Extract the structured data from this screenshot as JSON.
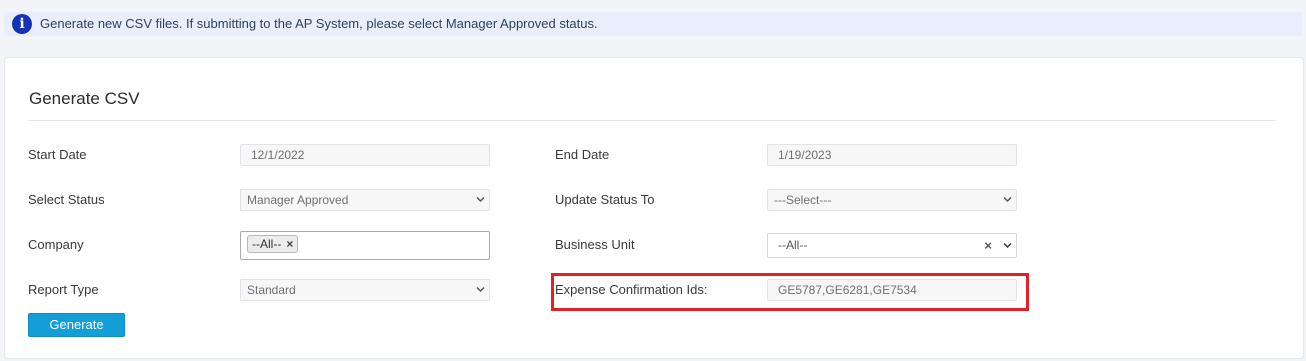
{
  "info": {
    "text": "Generate new CSV files. If submitting to the AP System, please select Manager Approved status."
  },
  "form": {
    "title": "Generate CSV",
    "start_date_label": "Start Date",
    "start_date_value": "12/1/2022",
    "end_date_label": "End Date",
    "end_date_value": "1/19/2023",
    "select_status_label": "Select Status",
    "select_status_value": "Manager Approved",
    "update_status_label": "Update Status To",
    "update_status_value": "---Select---",
    "company_label": "Company",
    "company_chip": "--All--",
    "business_unit_label": "Business Unit",
    "business_unit_value": "--All--",
    "report_type_label": "Report Type",
    "report_type_value": "Standard",
    "expense_ids_label": "Expense Confirmation Ids:",
    "expense_ids_value": "GE5787,GE6281,GE7534",
    "generate_button": "Generate"
  },
  "colors": {
    "accent": "#139ed8",
    "highlight": "#e0202a",
    "info_icon": "#1432b8"
  }
}
